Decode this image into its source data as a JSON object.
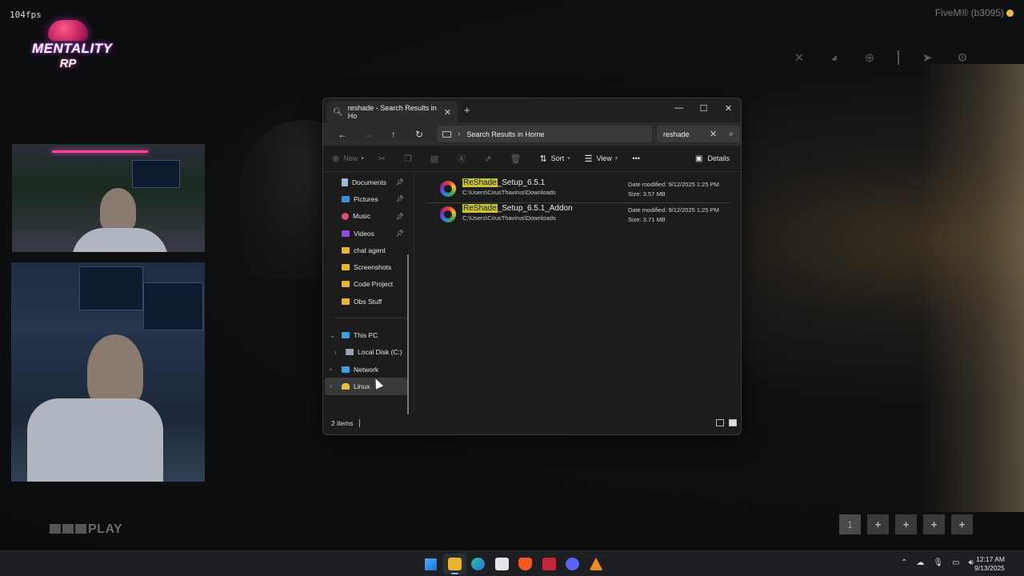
{
  "overlay": {
    "fps": "104fps",
    "logo_line1": "MENTALITY",
    "logo_line2": "RP",
    "fivem_label": "FiveM® (b3095)",
    "brand_play": "PLAY",
    "hotbar_slots": [
      "1",
      "+",
      "+",
      "+",
      "+"
    ],
    "icons": [
      "close-icon",
      "discord-icon",
      "globe-icon",
      "send-icon",
      "gear-icon"
    ]
  },
  "explorer": {
    "tab_title": "reshade - Search Results in Ho",
    "address": "Search Results in Home",
    "search_value": "reshade",
    "toolbar": {
      "new": "New",
      "sort": "Sort",
      "view": "View",
      "more": "•••",
      "details": "Details"
    },
    "nav": [
      {
        "label": "Documents",
        "icon": "documents-icon",
        "color": "#9fb7d8",
        "pinned": true
      },
      {
        "label": "Pictures",
        "icon": "pictures-icon",
        "color": "#3d8fd8",
        "pinned": true
      },
      {
        "label": "Music",
        "icon": "music-icon",
        "color": "#e0506a",
        "pinned": true
      },
      {
        "label": "Videos",
        "icon": "videos-icon",
        "color": "#8a4fd8",
        "pinned": true
      },
      {
        "label": "chat agent",
        "icon": "folder-icon",
        "color": "#e8b530",
        "pinned": false
      },
      {
        "label": "Screenshots",
        "icon": "folder-icon",
        "color": "#e8b530",
        "pinned": false
      },
      {
        "label": "Code Project",
        "icon": "folder-icon",
        "color": "#e8b530",
        "pinned": false
      },
      {
        "label": "Obs Stuff",
        "icon": "folder-icon",
        "color": "#e8b530",
        "pinned": false
      }
    ],
    "tree": {
      "this_pc": "This PC",
      "local_disk": "Local Disk (C:)",
      "network": "Network",
      "linux": "Linux"
    },
    "files": [
      {
        "highlight": "ReShade",
        "rest": "_Setup_6.5.1",
        "path": "C:\\Users\\CirusThavirus\\Downloads",
        "modified": "Date modified: 9/12/2025 1:25 PM",
        "size": "Size: 3.57 MB"
      },
      {
        "highlight": "ReShade",
        "rest": "_Setup_6.5.1_Addon",
        "path": "C:\\Users\\CirusThavirus\\Downloads",
        "modified": "Date modified: 9/12/2025 1:25 PM",
        "size": "Size: 3.71 MB"
      }
    ],
    "status": "2 items"
  },
  "taskbar": {
    "time": "12:17 AM",
    "date": "9/13/2025"
  }
}
